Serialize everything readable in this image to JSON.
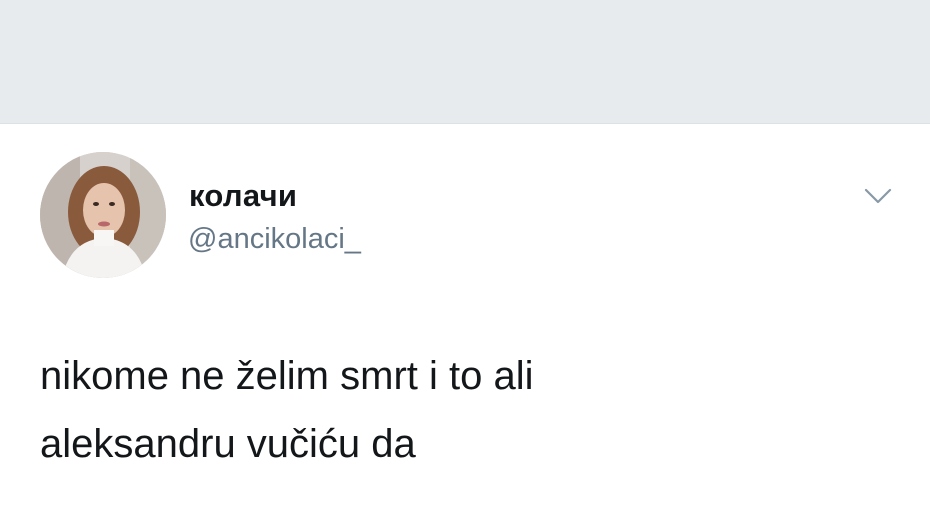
{
  "header": {
    "background_color": "#e8ebee"
  },
  "tweet": {
    "author": {
      "display_name": "колачи",
      "handle": "@ancikolaci_",
      "avatar_icon": "profile-photo"
    },
    "menu_icon": "chevron-down-icon",
    "text_lines": [
      "nikome ne želim smrt i to ali",
      "aleksandru vučiću da"
    ]
  },
  "colors": {
    "name": "#14171a",
    "handle": "#657786",
    "caret": "#8899a6"
  }
}
